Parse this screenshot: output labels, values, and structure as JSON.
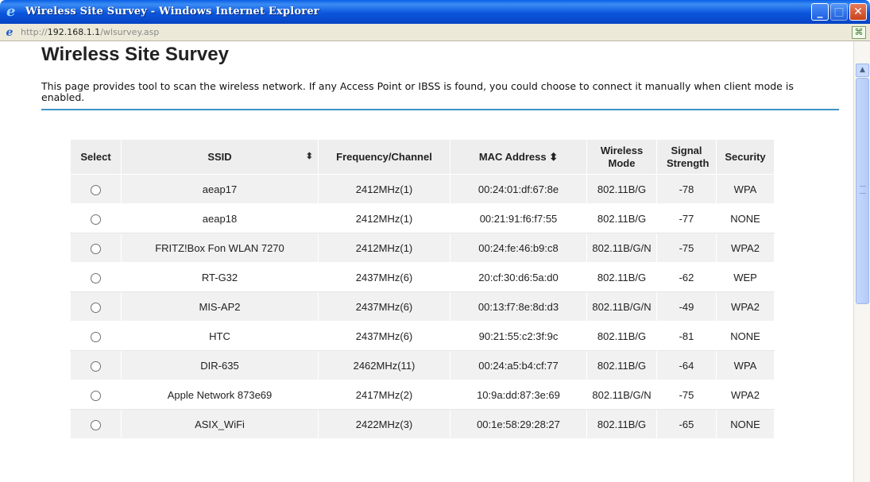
{
  "window": {
    "title": "Wireless Site Survey - Windows Internet Explorer",
    "url_prefix": "http://",
    "url_host": "192.168.1.1",
    "url_path": "/wlsurvey.asp"
  },
  "page": {
    "title": "Wireless Site Survey",
    "description": "This page provides tool to scan the wireless network. If any Access Point or IBSS is found, you could choose to connect it manually when client mode is enabled."
  },
  "table": {
    "headers": {
      "select": "Select",
      "ssid": "SSID",
      "frequency": "Frequency/Channel",
      "mac": "MAC Address",
      "mode": "Wireless Mode",
      "signal": "Signal Strength",
      "security": "Security"
    },
    "rows": [
      {
        "ssid": "aeap17",
        "frequency": "2412MHz(1)",
        "mac": "00:24:01:df:67:8e",
        "mode": "802.11B/G",
        "signal": "-78",
        "security": "WPA"
      },
      {
        "ssid": "aeap18",
        "frequency": "2412MHz(1)",
        "mac": "00:21:91:f6:f7:55",
        "mode": "802.11B/G",
        "signal": "-77",
        "security": "NONE"
      },
      {
        "ssid": "FRITZ!Box Fon WLAN 7270",
        "frequency": "2412MHz(1)",
        "mac": "00:24:fe:46:b9:c8",
        "mode": "802.11B/G/N",
        "signal": "-75",
        "security": "WPA2"
      },
      {
        "ssid": "RT-G32",
        "frequency": "2437MHz(6)",
        "mac": "20:cf:30:d6:5a:d0",
        "mode": "802.11B/G",
        "signal": "-62",
        "security": "WEP"
      },
      {
        "ssid": "MIS-AP2",
        "frequency": "2437MHz(6)",
        "mac": "00:13:f7:8e:8d:d3",
        "mode": "802.11B/G/N",
        "signal": "-49",
        "security": "WPA2"
      },
      {
        "ssid": "HTC",
        "frequency": "2437MHz(6)",
        "mac": "90:21:55:c2:3f:9c",
        "mode": "802.11B/G",
        "signal": "-81",
        "security": "NONE"
      },
      {
        "ssid": "DIR-635",
        "frequency": "2462MHz(11)",
        "mac": "00:24:a5:b4:cf:77",
        "mode": "802.11B/G",
        "signal": "-64",
        "security": "WPA"
      },
      {
        "ssid": "Apple Network 873e69",
        "frequency": "2417MHz(2)",
        "mac": "10:9a:dd:87:3e:69",
        "mode": "802.11B/G/N",
        "signal": "-75",
        "security": "WPA2"
      },
      {
        "ssid": "ASIX_WiFi",
        "frequency": "2422MHz(3)",
        "mac": "00:1e:58:29:28:27",
        "mode": "802.11B/G",
        "signal": "-65",
        "security": "NONE"
      }
    ]
  },
  "icons": {
    "browser": "ie-logo-icon",
    "page": "ie-page-icon",
    "compat": "compatibility-view-icon",
    "sort": "sort-arrows-icon"
  },
  "colors": {
    "titlebar": "#0b56dd",
    "rule": "#3e93c6",
    "header_bg": "#eeeeee",
    "row_alt": "#f1f1f1"
  }
}
